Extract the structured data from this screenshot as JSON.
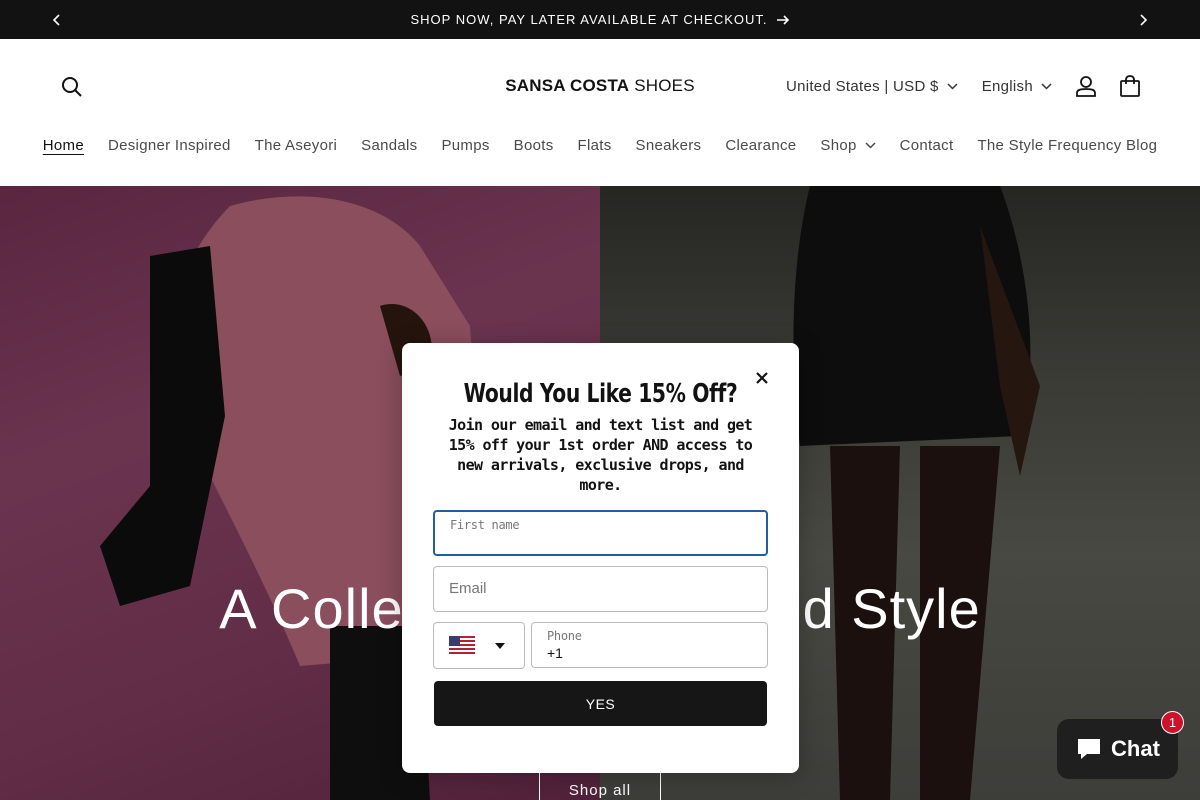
{
  "announcement": {
    "text": "SHOP NOW, PAY LATER AVAILABLE AT CHECKOUT."
  },
  "header": {
    "logo_bold": "SANSA COSTA",
    "logo_light": "SHOES",
    "country_selector": "United States | USD $",
    "language_selector": "English"
  },
  "nav": {
    "items": [
      {
        "label": "Home"
      },
      {
        "label": "Designer Inspired"
      },
      {
        "label": "The Aseyori"
      },
      {
        "label": "Sandals"
      },
      {
        "label": "Pumps"
      },
      {
        "label": "Boots"
      },
      {
        "label": "Flats"
      },
      {
        "label": "Sneakers"
      },
      {
        "label": "Clearance"
      },
      {
        "label": "Shop"
      },
      {
        "label": "Contact"
      },
      {
        "label": "The Style Frequency Blog"
      }
    ]
  },
  "hero": {
    "title": "A Collection of Elevated Style",
    "button": "Shop all"
  },
  "popup": {
    "title": "Would You Like 15% Off?",
    "subtitle": "Join our email and text list and get 15% off your 1st order AND access to new arrivals, exclusive drops, and more.",
    "first_name_label": "First name",
    "email_placeholder": "Email",
    "phone_label": "Phone",
    "phone_value": "+1",
    "submit": "YES"
  },
  "chat": {
    "label": "Chat",
    "badge": "1"
  },
  "colors": {
    "announce_bg": "#121212",
    "focus_border": "#1f5fa0",
    "button_dark": "#161616",
    "badge_red": "#d0112b"
  }
}
